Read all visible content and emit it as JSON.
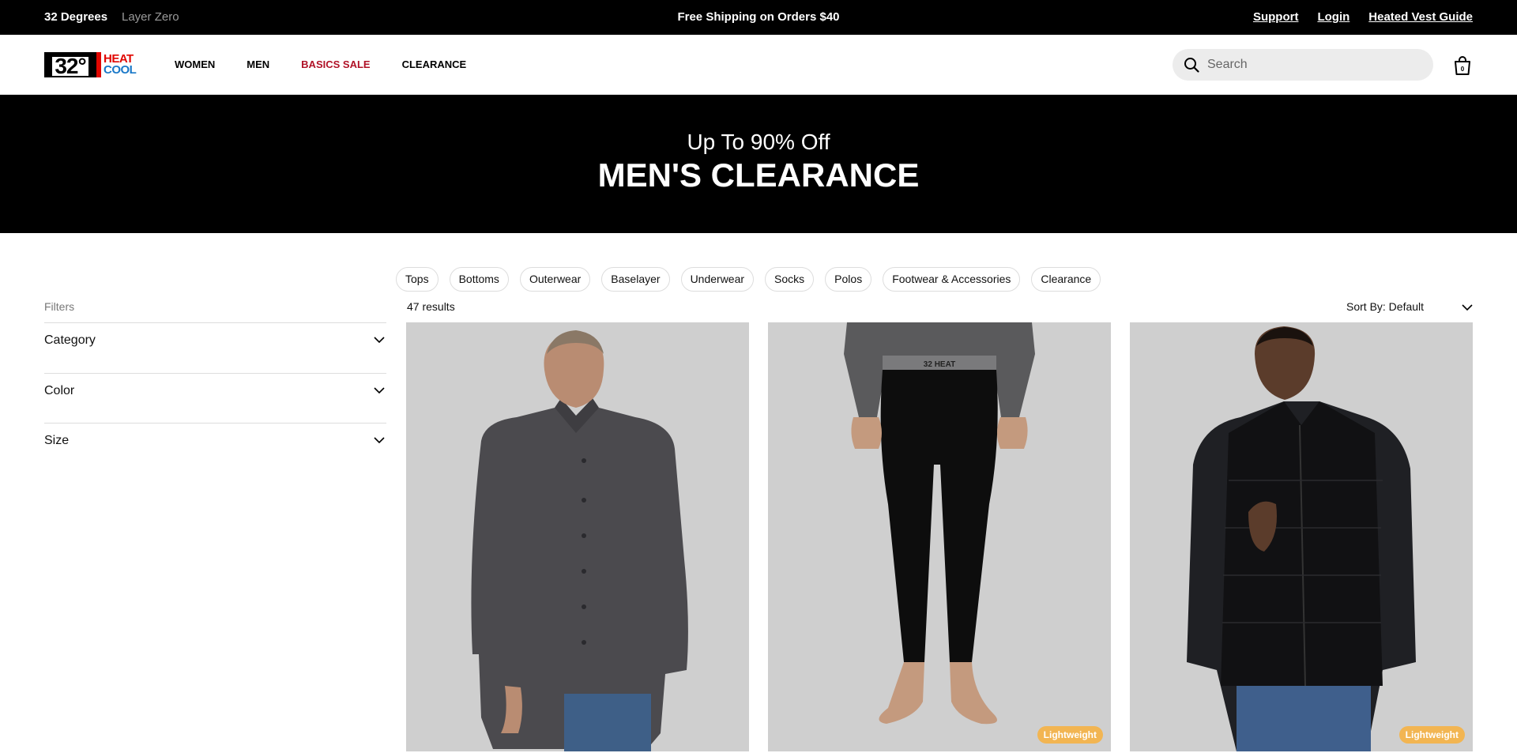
{
  "topbar": {
    "brand_primary": "32 Degrees",
    "brand_secondary": "Layer Zero",
    "promo": "Free Shipping on Orders $40",
    "links": [
      "Support",
      "Login",
      "Heated Vest Guide"
    ]
  },
  "header": {
    "logo": {
      "deg": "32°",
      "heat": "HEAT",
      "cool": "COOL"
    },
    "nav": [
      "WOMEN",
      "MEN",
      "BASICS SALE",
      "CLEARANCE"
    ],
    "search_placeholder": "Search"
  },
  "hero": {
    "subtitle": "Up To 90% Off",
    "title": "MEN'S CLEARANCE"
  },
  "categories": [
    "Tops",
    "Bottoms",
    "Outerwear",
    "Baselayer",
    "Underwear",
    "Socks",
    "Polos",
    "Footwear & Accessories",
    "Clearance"
  ],
  "filters": {
    "label": "Filters",
    "items": [
      "Category",
      "Color",
      "Size"
    ]
  },
  "results_count": "47 results",
  "sort_label": "Sort By: Default",
  "products": [
    {
      "badge": ""
    },
    {
      "badge": "Lightweight",
      "waistband": "32 HEAT"
    },
    {
      "badge": "Lightweight"
    }
  ],
  "colors": {
    "sale_red": "#b01227",
    "badge": "#f2b552",
    "card_bg": "#cfcfcf"
  }
}
